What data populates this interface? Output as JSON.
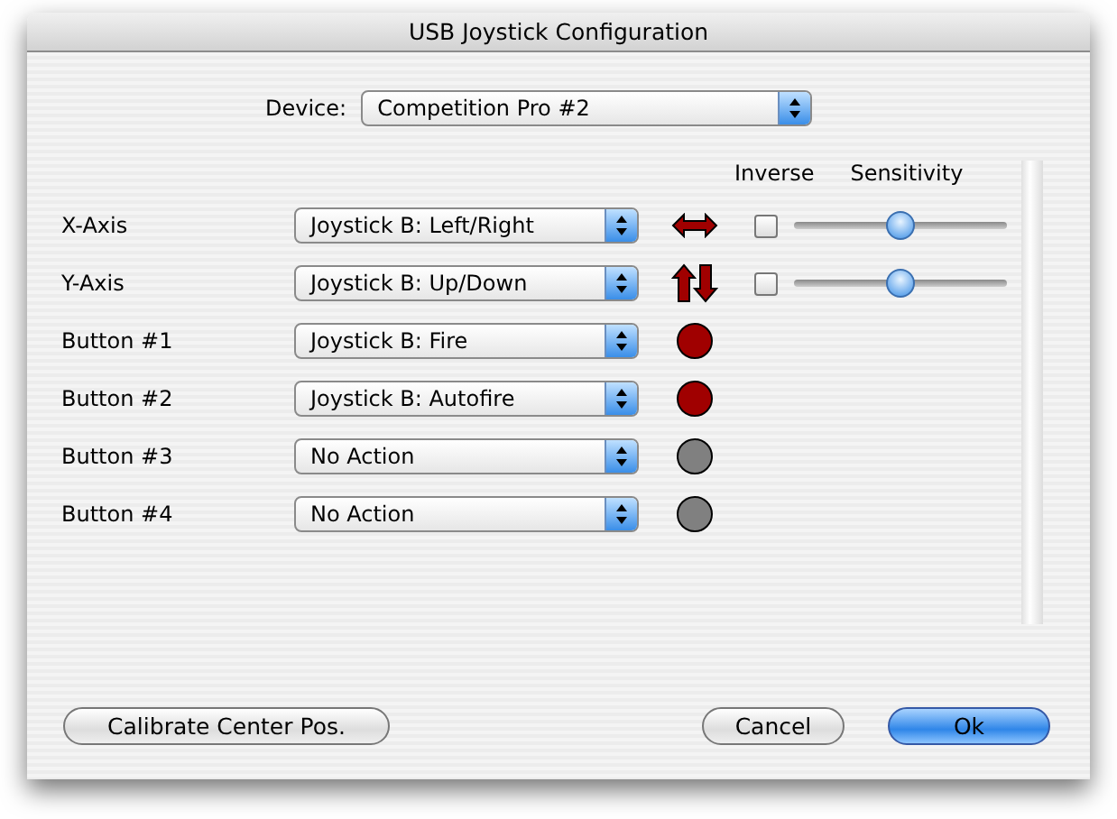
{
  "window": {
    "title": "USB Joystick Configuration"
  },
  "device": {
    "label": "Device:",
    "value": "Competition Pro #2"
  },
  "headers": {
    "inverse": "Inverse",
    "sensitivity": "Sensitivity"
  },
  "mappings": [
    {
      "label": "X-Axis",
      "value": "Joystick B: Left/Right",
      "kind": "horizontal-axis",
      "inverse": false,
      "level": 0.5
    },
    {
      "label": "Y-Axis",
      "value": "Joystick B: Up/Down",
      "kind": "vertical-axis",
      "inverse": false,
      "level": 0.5
    },
    {
      "label": "Button #1",
      "value": "Joystick B: Fire",
      "kind": "button",
      "color": "#a00000"
    },
    {
      "label": "Button #2",
      "value": "Joystick B: Autofire",
      "kind": "button",
      "color": "#a00000"
    },
    {
      "label": "Button #3",
      "value": "No Action",
      "kind": "button",
      "color": "#808080"
    },
    {
      "label": "Button #4",
      "value": "No Action",
      "kind": "button",
      "color": "#808080"
    }
  ],
  "buttons": [
    {
      "label": "Calibrate Center Pos.",
      "kind": "normal"
    },
    {
      "label": "Cancel",
      "kind": "normal"
    },
    {
      "label": "Ok",
      "kind": "default"
    }
  ]
}
